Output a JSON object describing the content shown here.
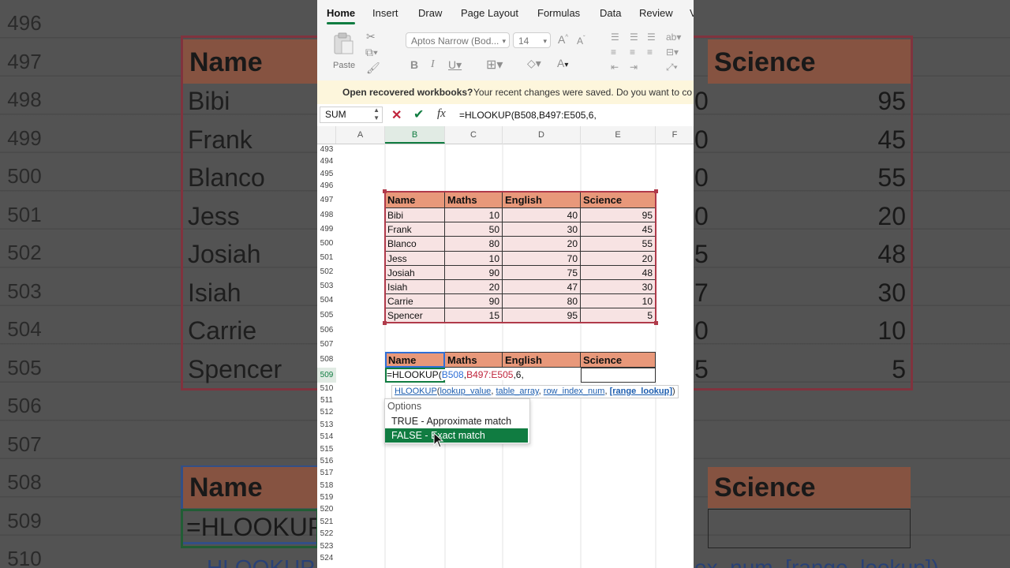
{
  "ribbon_tabs": [
    "Home",
    "Insert",
    "Draw",
    "Page Layout",
    "Formulas",
    "Data",
    "Review",
    "V"
  ],
  "clipboard": {
    "paste_label": "Paste"
  },
  "font": {
    "name": "Aptos Narrow (Bod...",
    "size": "14"
  },
  "message_bar": {
    "title": "Open recovered workbooks?",
    "text": "Your recent changes were saved. Do you want to co"
  },
  "formula_bar": {
    "name_box": "SUM",
    "formula": "=HLOOKUP(B508,B497:E505,6,",
    "fx": "fx"
  },
  "columns": [
    "A",
    "B",
    "C",
    "D",
    "E",
    "F"
  ],
  "row_numbers": [
    "493",
    "494",
    "495",
    "496",
    "497",
    "498",
    "499",
    "500",
    "501",
    "502",
    "503",
    "504",
    "505",
    "506",
    "507",
    "508",
    "509",
    "510",
    "511",
    "512",
    "513",
    "514",
    "515",
    "516",
    "517",
    "518",
    "519",
    "520",
    "521",
    "522",
    "523",
    "524"
  ],
  "table": {
    "headers": [
      "Name",
      "Maths",
      "English",
      "Science"
    ],
    "rows": [
      [
        "Bibi",
        "10",
        "40",
        "95"
      ],
      [
        "Frank",
        "50",
        "30",
        "45"
      ],
      [
        "Blanco",
        "80",
        "20",
        "55"
      ],
      [
        "Jess",
        "10",
        "70",
        "20"
      ],
      [
        "Josiah",
        "90",
        "75",
        "48"
      ],
      [
        "Isiah",
        "20",
        "47",
        "30"
      ],
      [
        "Carrie",
        "90",
        "80",
        "10"
      ],
      [
        "Spencer",
        "15",
        "95",
        "5"
      ]
    ]
  },
  "lookup_table": {
    "headers": [
      "Name",
      "Maths",
      "English",
      "Science"
    ],
    "edit_cell": {
      "prefix": "=HLOOKUP(",
      "ref1": "B508",
      "sep1": ",",
      "ref2": "B497:E505",
      "suffix": ",6,"
    }
  },
  "tooltip": {
    "fn": "HLOOKUP",
    "open": "(",
    "arg1": "lookup_value",
    "arg2": "table_array",
    "arg3": "row_index_num",
    "arg4": "[range_lookup]",
    "close": ")"
  },
  "options_popup": {
    "title": "Options",
    "items": [
      "TRUE - Approximate match",
      "FALSE - Exact match"
    ],
    "selected_index": 1
  },
  "background": {
    "row_numbers": [
      "496",
      "497",
      "498",
      "499",
      "500",
      "501",
      "502",
      "503",
      "504",
      "505",
      "506",
      "507",
      "508",
      "509",
      "510"
    ],
    "name_header": "Name",
    "science_header": "Science",
    "names": [
      "Bibi",
      "Frank",
      "Blanco",
      "Jess",
      "Josiah",
      "Isiah",
      "Carrie",
      "Spencer"
    ],
    "science_values": [
      "95",
      "45",
      "55",
      "20",
      "48",
      "30",
      "10",
      "5"
    ],
    "partial_left": [
      "0",
      "0",
      "0",
      "0",
      "5",
      "7",
      "0",
      "5"
    ],
    "formula_partial": "=HLOOKUP",
    "bottom_left_text": "HLOOKUP",
    "bottom_right_text": "ex_num, [range_lookup])"
  },
  "colors": {
    "accent_green": "#107c41",
    "header_fill": "#e8987a",
    "data_fill": "#f7e3e3",
    "ref_blue": "#2f6fd6",
    "ref_red": "#c0243c"
  }
}
